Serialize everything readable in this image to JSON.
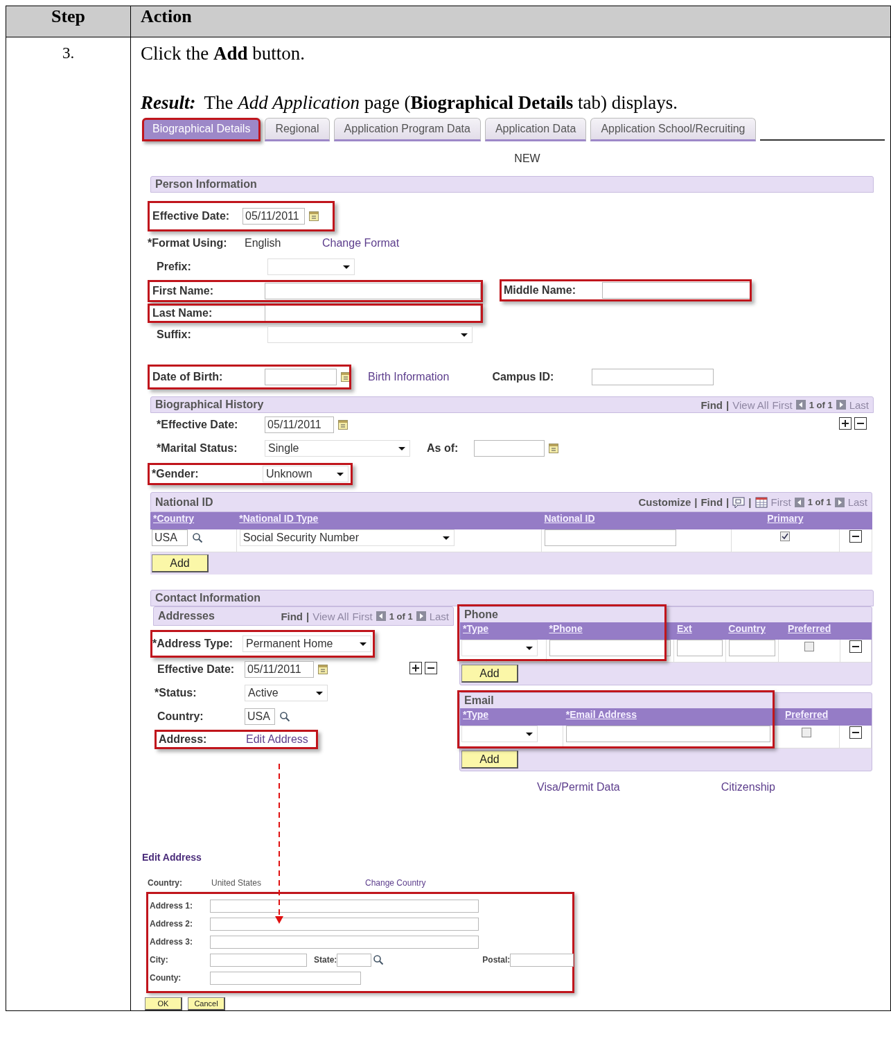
{
  "table": {
    "columns": [
      "Step",
      "Action"
    ]
  },
  "rows": [
    {
      "step": "3.",
      "instruction": "Click the **Add** button.",
      "result_label": "Result:",
      "result_text": "The *Add Application* page (**Biographical Details** tab) displays."
    }
  ],
  "app": {
    "tabs": [
      {
        "label": "Biographical Details",
        "selected": true,
        "highlighted": true
      },
      {
        "label": "Regional",
        "selected": false,
        "highlighted": false
      },
      {
        "label": "Application Program Data",
        "selected": false,
        "highlighted": false
      },
      {
        "label": "Application Data",
        "selected": false,
        "highlighted": false
      },
      {
        "label": "Application School/Recruiting",
        "selected": false,
        "highlighted": false
      }
    ],
    "mode": "NEW",
    "person_information": {
      "title": "Person Information",
      "effective_date": {
        "label": "Effective Date:",
        "value": "05/11/2011",
        "highlighted": true
      },
      "format_using": {
        "label": "*Format Using:",
        "value": "English",
        "link": "Change Format"
      },
      "prefix": {
        "label": "Prefix:"
      },
      "first_name": {
        "label": "First Name:",
        "highlighted": true
      },
      "middle_name": {
        "label": "Middle Name:",
        "highlighted": true
      },
      "last_name": {
        "label": "Last Name:",
        "highlighted": true
      },
      "suffix": {
        "label": "Suffix:"
      },
      "date_of_birth": {
        "label": "Date of Birth:",
        "highlighted": true
      },
      "birth_information": "Birth Information",
      "campus_id": {
        "label": "Campus ID:"
      }
    },
    "biographical_history": {
      "title": "Biographical History",
      "nav": [
        {
          "kind": "link",
          "text": "Find"
        },
        {
          "kind": "sep",
          "text": "|"
        },
        {
          "kind": "disabled",
          "text": "View All"
        },
        {
          "kind": "disabled",
          "text": "First"
        },
        {
          "kind": "prev"
        },
        {
          "kind": "count",
          "text": "1 of 1"
        },
        {
          "kind": "next"
        },
        {
          "kind": "disabled",
          "text": "Last"
        }
      ],
      "effective_date": {
        "label": "*Effective Date:",
        "value": "05/11/2011"
      },
      "marital_status": {
        "label": "*Marital Status:",
        "value": "Single"
      },
      "as_of": {
        "label": "As of:"
      },
      "gender": {
        "label": "*Gender:",
        "value": "Unknown",
        "highlighted": true
      }
    },
    "national_id": {
      "title": "National ID",
      "nav": [
        {
          "kind": "link",
          "text": "Customize"
        },
        {
          "kind": "sep",
          "text": "|"
        },
        {
          "kind": "link",
          "text": "Find"
        },
        {
          "kind": "sep",
          "text": "|"
        },
        {
          "kind": "zoom"
        },
        {
          "kind": "sep",
          "text": "|"
        },
        {
          "kind": "grid"
        },
        {
          "kind": "disabled",
          "text": "First"
        },
        {
          "kind": "prev"
        },
        {
          "kind": "count",
          "text": "1 of 1"
        },
        {
          "kind": "next"
        },
        {
          "kind": "disabled",
          "text": "Last"
        }
      ],
      "columns": [
        "*Country",
        "*National ID Type",
        "National ID",
        "Primary"
      ],
      "rows": [
        {
          "country": "USA",
          "id_type": "Social Security Number",
          "primary": true
        }
      ],
      "add_button": "Add"
    },
    "contact_information": {
      "title": "Contact Information",
      "addresses": {
        "title": "Addresses",
        "nav": [
          {
            "kind": "link",
            "text": "Find"
          },
          {
            "kind": "sep",
            "text": "|"
          },
          {
            "kind": "disabled",
            "text": "View All"
          },
          {
            "kind": "disabled",
            "text": "First"
          },
          {
            "kind": "prev"
          },
          {
            "kind": "count",
            "text": "1 of 1"
          },
          {
            "kind": "next"
          },
          {
            "kind": "disabled",
            "text": "Last"
          }
        ],
        "address_type": {
          "label": "*Address Type:",
          "value": "Permanent Home",
          "highlighted": true
        },
        "effective_date": {
          "label": "Effective Date:",
          "value": "05/11/2011"
        },
        "status": {
          "label": "*Status:",
          "value": "Active"
        },
        "country": {
          "label": "Country:",
          "value": "USA"
        },
        "address": {
          "label": "Address:",
          "link": "Edit Address",
          "highlighted": true
        }
      },
      "phone": {
        "title": "Phone",
        "highlighted": true,
        "columns": [
          "*Type",
          "*Phone",
          "Ext",
          "Country",
          "Preferred"
        ],
        "rows": [
          {
            "preferred": false
          }
        ],
        "add_button": "Add"
      },
      "email": {
        "title": "Email",
        "highlighted": true,
        "columns": [
          "*Type",
          "*Email Address",
          "Preferred"
        ],
        "rows": [
          {
            "preferred": false
          }
        ],
        "add_button": "Add"
      },
      "links": [
        "Visa/Permit Data",
        "Citizenship"
      ]
    },
    "edit_address": {
      "title": "Edit Address",
      "highlighted": true,
      "country": {
        "label": "Country:",
        "value": "United States",
        "link": "Change Country"
      },
      "lines": [
        [
          {
            "label": "Address 1:",
            "kind": "long"
          }
        ],
        [
          {
            "label": "Address 2:",
            "kind": "long"
          }
        ],
        [
          {
            "label": "Address 3:",
            "kind": "long"
          }
        ],
        [
          {
            "label": "City:",
            "kind": "medium"
          },
          {
            "label": "State:",
            "kind": "lookup"
          },
          {
            "label": "Postal:",
            "kind": "short"
          }
        ],
        [
          {
            "label": "County:",
            "kind": "county"
          }
        ]
      ],
      "buttons": [
        "OK",
        "Cancel"
      ]
    }
  }
}
